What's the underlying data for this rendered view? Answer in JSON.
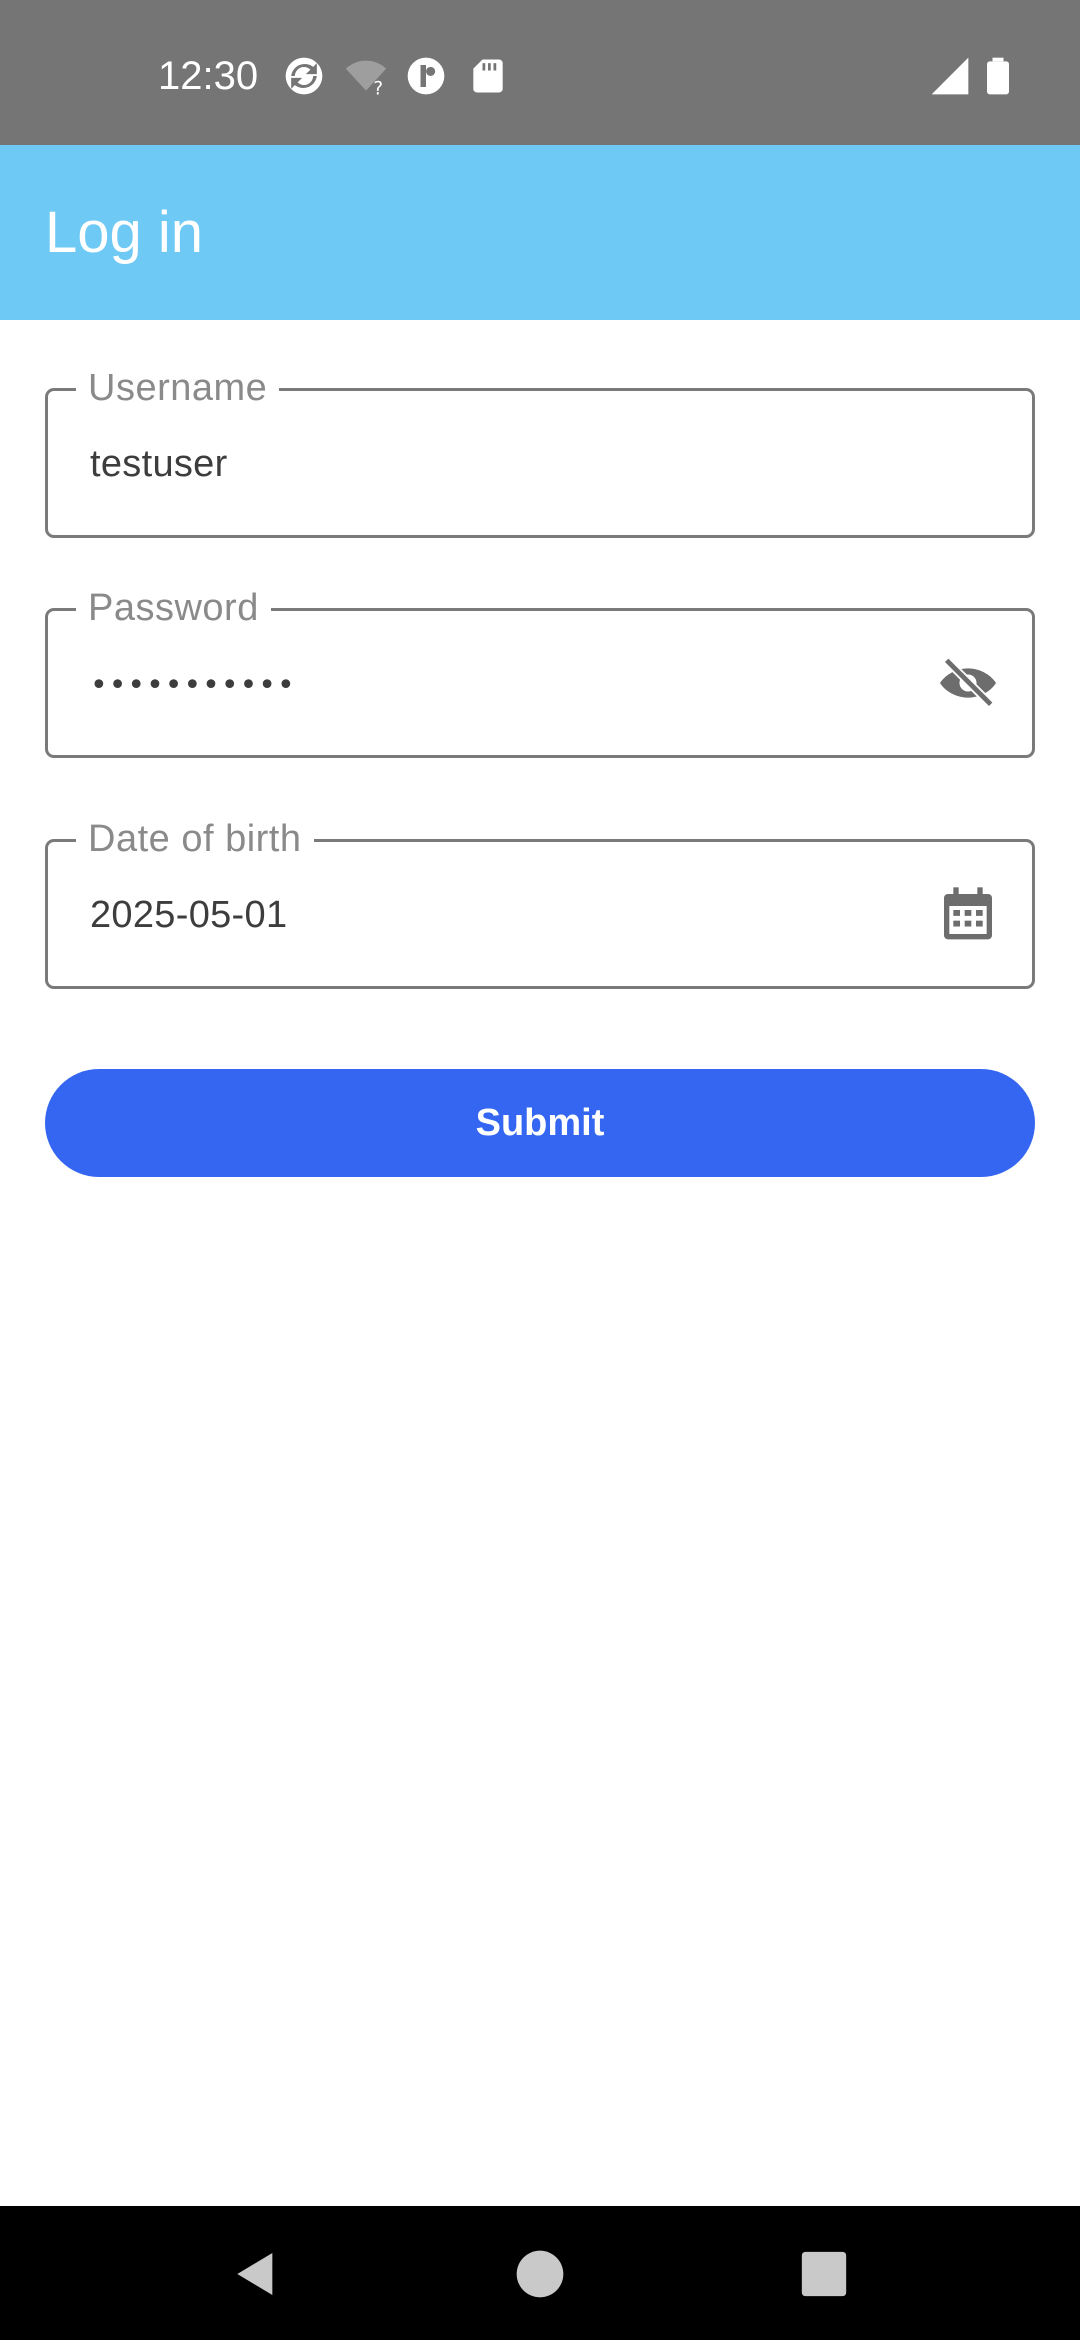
{
  "status_bar": {
    "time": "12:30",
    "icons": [
      "sync-icon",
      "wifi-unknown-icon",
      "app-notification-icon",
      "sd-card-icon",
      "cell-signal-icon",
      "battery-icon"
    ]
  },
  "app_bar": {
    "title": "Log in"
  },
  "form": {
    "username": {
      "label": "Username",
      "value": "testuser"
    },
    "password": {
      "label": "Password",
      "value": "•••••••••••",
      "trailing_icon": "visibility-off-icon"
    },
    "date_of_birth": {
      "label": "Date of birth",
      "value": "2025-05-01",
      "trailing_icon": "calendar-icon"
    },
    "submit_label": "Submit"
  },
  "nav_bar": {
    "buttons": [
      "back-icon",
      "home-icon",
      "recents-icon"
    ]
  },
  "colors": {
    "status_bar": "#757575",
    "app_bar": "#6ec9f4",
    "button": "#3566f2",
    "field_border": "#7a7a7a",
    "nav_bar": "#000000"
  }
}
